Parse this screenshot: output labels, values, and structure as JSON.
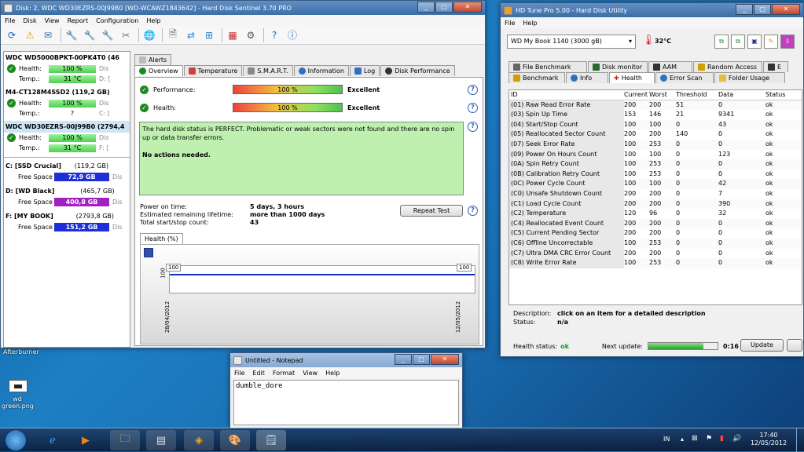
{
  "hds": {
    "title": "Disk: 2, WDC WD30EZRS-00J99B0 [WD-WCAWZ1843642]  -  Hard Disk Sentinel 3.70 PRO",
    "menu": [
      "File",
      "Disk",
      "View",
      "Report",
      "Configuration",
      "Help"
    ],
    "disks": [
      {
        "name": "WDC WD5000BPKT-00PK4T0 (46",
        "health": "100 %",
        "temp": "31 °C",
        "ghost_h": "Dis",
        "ghost_t": "D: ["
      },
      {
        "name": "M4-CT128M4SSD2 (119,2 GB)",
        "health": "100 %",
        "temp": "?",
        "ghost_h": "Dis",
        "ghost_t": "C: ["
      },
      {
        "name": "WDC WD30EZRS-00J99B0 (2794,4",
        "health": "100 %",
        "temp": "31 °C",
        "ghost_h": "Dis",
        "ghost_t": "F: ["
      }
    ],
    "health_label": "Health:",
    "temp_label": "Temp.:",
    "volumes": [
      {
        "name": "C: [SSD Crucial]",
        "size": "(119,2 GB)",
        "free": "72,9 GB",
        "color": "#1d2fd8",
        "ghost": "Dis"
      },
      {
        "name": "D: [WD Black]",
        "size": "(465,7 GB)",
        "free": "400,8 GB",
        "color": "#a020c0",
        "ghost": "Dis"
      },
      {
        "name": "F: [MY BOOK]",
        "size": "(2793,8 GB)",
        "free": "151,2 GB",
        "color": "#1d2fd8",
        "ghost": "Dis"
      }
    ],
    "free_label": "Free Space",
    "alerts_tab": "Alerts",
    "tabs": [
      "Overview",
      "Temperature",
      "S.M.A.R.T.",
      "Information",
      "Log",
      "Disk Performance"
    ],
    "performance_label": "Performance:",
    "performance_value": "100 %",
    "performance_rating": "Excellent",
    "health_label2": "Health:",
    "health_value": "100 %",
    "health_rating": "Excellent",
    "status_text": "The hard disk status is PERFECT. Problematic or weak sectors were not found and there are no spin up or data transfer errors.",
    "actions_text": "No actions needed.",
    "power_on_label": "Power on time:",
    "power_on_value": "5 days, 3 hours",
    "lifetime_label": "Estimated remaining lifetime:",
    "lifetime_value": "more than 1000 days",
    "startstop_label": "Total start/stop count:",
    "startstop_value": "43",
    "repeat_test": "Repeat Test",
    "graph_tab": "Health (%)",
    "graph_y": "100",
    "graph_start_label": "100",
    "graph_end_label": "100",
    "graph_date_start": "28/04/2012",
    "graph_date_end": "12/05/2012"
  },
  "hdt": {
    "title": "HD Tune Pro 5.00 - Hard Disk Utility",
    "menu": [
      "File",
      "Help"
    ],
    "drive": "WD     My Book 1140   (3000 gB)",
    "temp": "32°C",
    "tabs_row1": [
      "File Benchmark",
      "Disk monitor",
      "AAM",
      "Random Access",
      "E"
    ],
    "tabs_row2": [
      "Benchmark",
      "Info",
      "Health",
      "Error Scan",
      "Folder Usage"
    ],
    "columns": [
      "ID",
      "Current",
      "Worst",
      "Threshold",
      "Data",
      "Status"
    ],
    "rows": [
      [
        "(01) Raw Read Error Rate",
        "200",
        "200",
        "51",
        "0",
        "ok"
      ],
      [
        "(03) Spin Up Time",
        "153",
        "146",
        "21",
        "9341",
        "ok"
      ],
      [
        "(04) Start/Stop Count",
        "100",
        "100",
        "0",
        "43",
        "ok"
      ],
      [
        "(05) Reallocated Sector Count",
        "200",
        "200",
        "140",
        "0",
        "ok"
      ],
      [
        "(07) Seek Error Rate",
        "100",
        "253",
        "0",
        "0",
        "ok"
      ],
      [
        "(09) Power On Hours Count",
        "100",
        "100",
        "0",
        "123",
        "ok"
      ],
      [
        "(0A) Spin Retry Count",
        "100",
        "253",
        "0",
        "0",
        "ok"
      ],
      [
        "(0B) Calibration Retry Count",
        "100",
        "253",
        "0",
        "0",
        "ok"
      ],
      [
        "(0C) Power Cycle Count",
        "100",
        "100",
        "0",
        "42",
        "ok"
      ],
      [
        "(C0) Unsafe Shutdown Count",
        "200",
        "200",
        "0",
        "7",
        "ok"
      ],
      [
        "(C1) Load Cycle Count",
        "200",
        "200",
        "0",
        "390",
        "ok"
      ],
      [
        "(C2) Temperature",
        "120",
        "96",
        "0",
        "32",
        "ok"
      ],
      [
        "(C4) Reallocated Event Count",
        "200",
        "200",
        "0",
        "0",
        "ok"
      ],
      [
        "(C5) Current Pending Sector",
        "200",
        "200",
        "0",
        "0",
        "ok"
      ],
      [
        "(C6) Offline Uncorrectable",
        "100",
        "253",
        "0",
        "0",
        "ok"
      ],
      [
        "(C7) Ultra DMA CRC Error Count",
        "200",
        "200",
        "0",
        "0",
        "ok"
      ],
      [
        "(C8) Write Error Rate",
        "100",
        "253",
        "0",
        "0",
        "ok"
      ]
    ],
    "desc_label": "Description:",
    "desc_value": "click on an item for a detailed description",
    "status_label": "Status:",
    "status_value": "n/a",
    "health_status_label": "Health status:",
    "health_status_value": "ok",
    "next_update_label": "Next update:",
    "next_update_value": "0:16",
    "next_update_progress": 0.8,
    "update_button": "Update"
  },
  "notepad": {
    "title": "Untitled - Notepad",
    "menu": [
      "File",
      "Edit",
      "Format",
      "View",
      "Help"
    ],
    "text": "dumble_dore"
  },
  "desktop": {
    "afterburner": "Afterburner",
    "file_label": "wd green.png"
  },
  "taskbar": {
    "lang": "IN",
    "time": "17:40",
    "date": "12/05/2012"
  }
}
